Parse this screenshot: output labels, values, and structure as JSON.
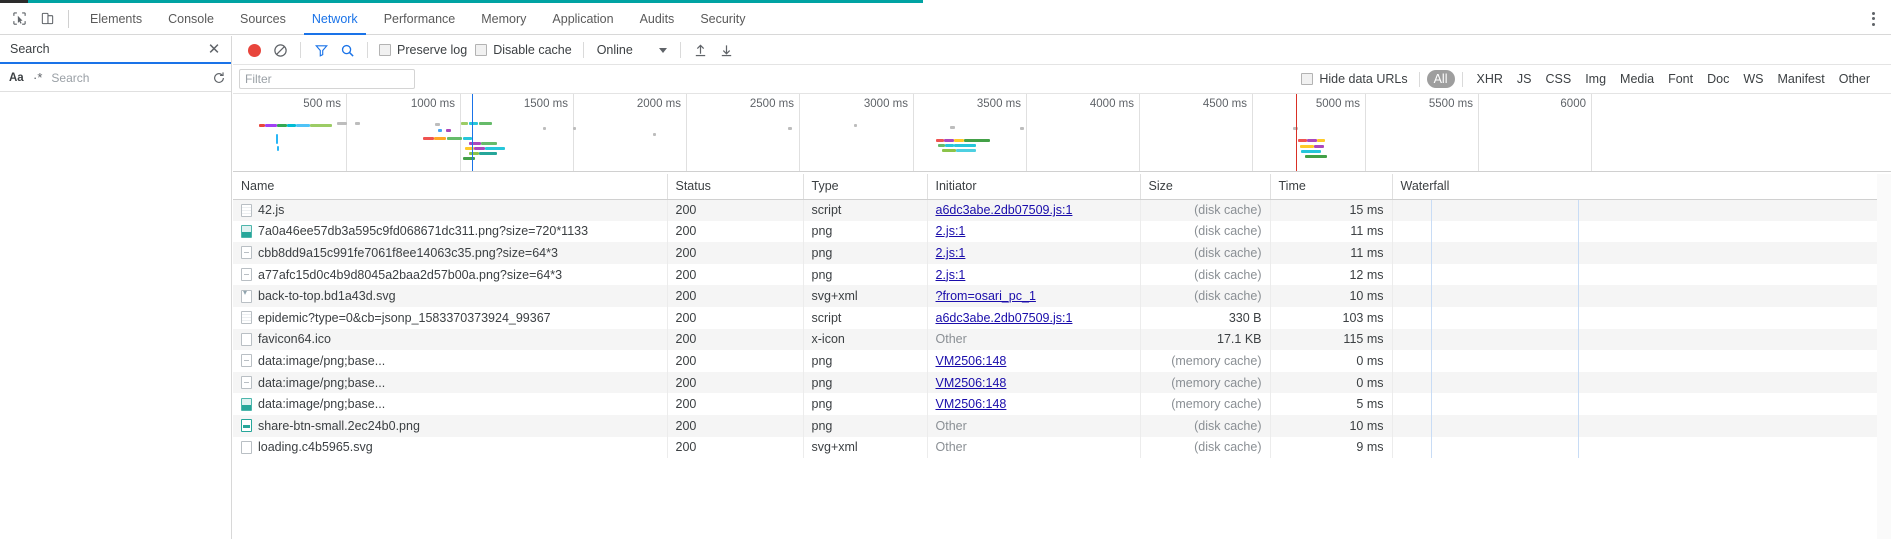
{
  "window": {
    "accent_color": "#00a3a3",
    "active_tab_color": "#1a73e8"
  },
  "devtools_tabs": {
    "inspect_icon": "inspect-cursor-icon",
    "device_icon": "device-toolbar-icon",
    "items": [
      {
        "label": "Elements",
        "active": false
      },
      {
        "label": "Console",
        "active": false
      },
      {
        "label": "Sources",
        "active": false
      },
      {
        "label": "Network",
        "active": true
      },
      {
        "label": "Performance",
        "active": false
      },
      {
        "label": "Memory",
        "active": false
      },
      {
        "label": "Application",
        "active": false
      },
      {
        "label": "Audits",
        "active": false
      },
      {
        "label": "Security",
        "active": false
      }
    ],
    "more_icon": "kebab-menu-icon"
  },
  "search_drawer": {
    "title": "Search",
    "close_icon": "close-icon",
    "match_case_label": "Aa",
    "regex_label": "·*",
    "input_placeholder": "Search",
    "input_value": "",
    "refresh_icon": "refresh-icon",
    "clear_icon": "clear-icon"
  },
  "network_toolbar": {
    "record_icon": "record-button-icon",
    "clear_icon": "clear-icon",
    "filter_icon": "filter-funnel-icon",
    "search_icon": "search-icon",
    "preserve_log": {
      "label": "Preserve log",
      "checked": false
    },
    "disable_cache": {
      "label": "Disable cache",
      "checked": false
    },
    "throttling": {
      "value": "Online",
      "dropdown_icon": "chevron-down-icon"
    },
    "import_icon": "import-har-icon",
    "export_icon": "export-har-icon"
  },
  "filter_bar": {
    "filter_placeholder": "Filter",
    "filter_value": "",
    "hide_data_urls": {
      "label": "Hide data URLs",
      "checked": false
    },
    "types": [
      {
        "label": "All",
        "selected": true
      },
      {
        "label": "XHR",
        "selected": false
      },
      {
        "label": "JS",
        "selected": false
      },
      {
        "label": "CSS",
        "selected": false
      },
      {
        "label": "Img",
        "selected": false
      },
      {
        "label": "Media",
        "selected": false
      },
      {
        "label": "Font",
        "selected": false
      },
      {
        "label": "Doc",
        "selected": false
      },
      {
        "label": "WS",
        "selected": false
      },
      {
        "label": "Manifest",
        "selected": false
      },
      {
        "label": "Other",
        "selected": false
      }
    ]
  },
  "overview": {
    "tick_labels": [
      "500 ms",
      "1000 ms",
      "1500 ms",
      "2000 ms",
      "2500 ms",
      "3000 ms",
      "3500 ms",
      "4000 ms",
      "4500 ms",
      "5000 ms",
      "5500 ms",
      "6000"
    ],
    "dom_content_loaded_color": "#1a73e8",
    "load_event_color": "#d93025"
  },
  "table": {
    "columns": [
      "Name",
      "Status",
      "Type",
      "Initiator",
      "Size",
      "Time",
      "Waterfall"
    ],
    "rows": [
      {
        "icon": "file-generic-icon",
        "name": "42.js",
        "status": "200",
        "type": "script",
        "initiator": "a6dc3abe.2db07509.js:1",
        "initiator_link": true,
        "size": "(disk cache)",
        "size_cached": true,
        "time": "15 ms"
      },
      {
        "icon": "file-image-icon",
        "name": "7a0a46ee57db3a595c9fd068671dc311.png?size=720*1133",
        "status": "200",
        "type": "png",
        "initiator": "2.js:1",
        "initiator_link": true,
        "size": "(disk cache)",
        "size_cached": true,
        "time": "11 ms"
      },
      {
        "icon": "file-image-small-icon",
        "name": "cbb8dd9a15c991fe7061f8ee14063c35.png?size=64*3",
        "status": "200",
        "type": "png",
        "initiator": "2.js:1",
        "initiator_link": true,
        "size": "(disk cache)",
        "size_cached": true,
        "time": "11 ms"
      },
      {
        "icon": "file-image-small-icon",
        "name": "a77afc15d0c4b9d8045a2baa2d57b00a.png?size=64*3",
        "status": "200",
        "type": "png",
        "initiator": "2.js:1",
        "initiator_link": true,
        "size": "(disk cache)",
        "size_cached": true,
        "time": "12 ms"
      },
      {
        "icon": "file-svg-icon",
        "name": "back-to-top.bd1a43d.svg",
        "status": "200",
        "type": "svg+xml",
        "initiator": "?from=osari_pc_1",
        "initiator_link": true,
        "size": "(disk cache)",
        "size_cached": true,
        "time": "10 ms"
      },
      {
        "icon": "file-script-icon",
        "name": "epidemic?type=0&cb=jsonp_1583370373924_99367",
        "status": "200",
        "type": "script",
        "initiator": "a6dc3abe.2db07509.js:1",
        "initiator_link": true,
        "size": "330 B",
        "size_cached": false,
        "time": "103 ms"
      },
      {
        "icon": "file-generic-icon",
        "name": "favicon64.ico",
        "status": "200",
        "type": "x-icon",
        "initiator": "Other",
        "initiator_link": false,
        "size": "17.1 KB",
        "size_cached": false,
        "time": "115 ms"
      },
      {
        "icon": "file-image-small-icon",
        "name": "data:image/png;base...",
        "status": "200",
        "type": "png",
        "initiator": "VM2506:148",
        "initiator_link": true,
        "size": "(memory cache)",
        "size_cached": true,
        "time": "0 ms"
      },
      {
        "icon": "file-image-small-icon",
        "name": "data:image/png;base...",
        "status": "200",
        "type": "png",
        "initiator": "VM2506:148",
        "initiator_link": true,
        "size": "(memory cache)",
        "size_cached": true,
        "time": "0 ms"
      },
      {
        "icon": "file-image-icon",
        "name": "data:image/png;base...",
        "status": "200",
        "type": "png",
        "initiator": "VM2506:148",
        "initiator_link": true,
        "size": "(memory cache)",
        "size_cached": true,
        "time": "5 ms"
      },
      {
        "icon": "file-media-icon",
        "name": "share-btn-small.2ec24b0.png",
        "status": "200",
        "type": "png",
        "initiator": "Other",
        "initiator_link": false,
        "size": "(disk cache)",
        "size_cached": true,
        "time": "10 ms"
      },
      {
        "icon": "file-generic-icon",
        "name": "loading.c4b5965.svg",
        "status": "200",
        "type": "svg+xml",
        "initiator": "Other",
        "initiator_link": false,
        "size": "(disk cache)",
        "size_cached": true,
        "time": "9 ms"
      }
    ]
  }
}
